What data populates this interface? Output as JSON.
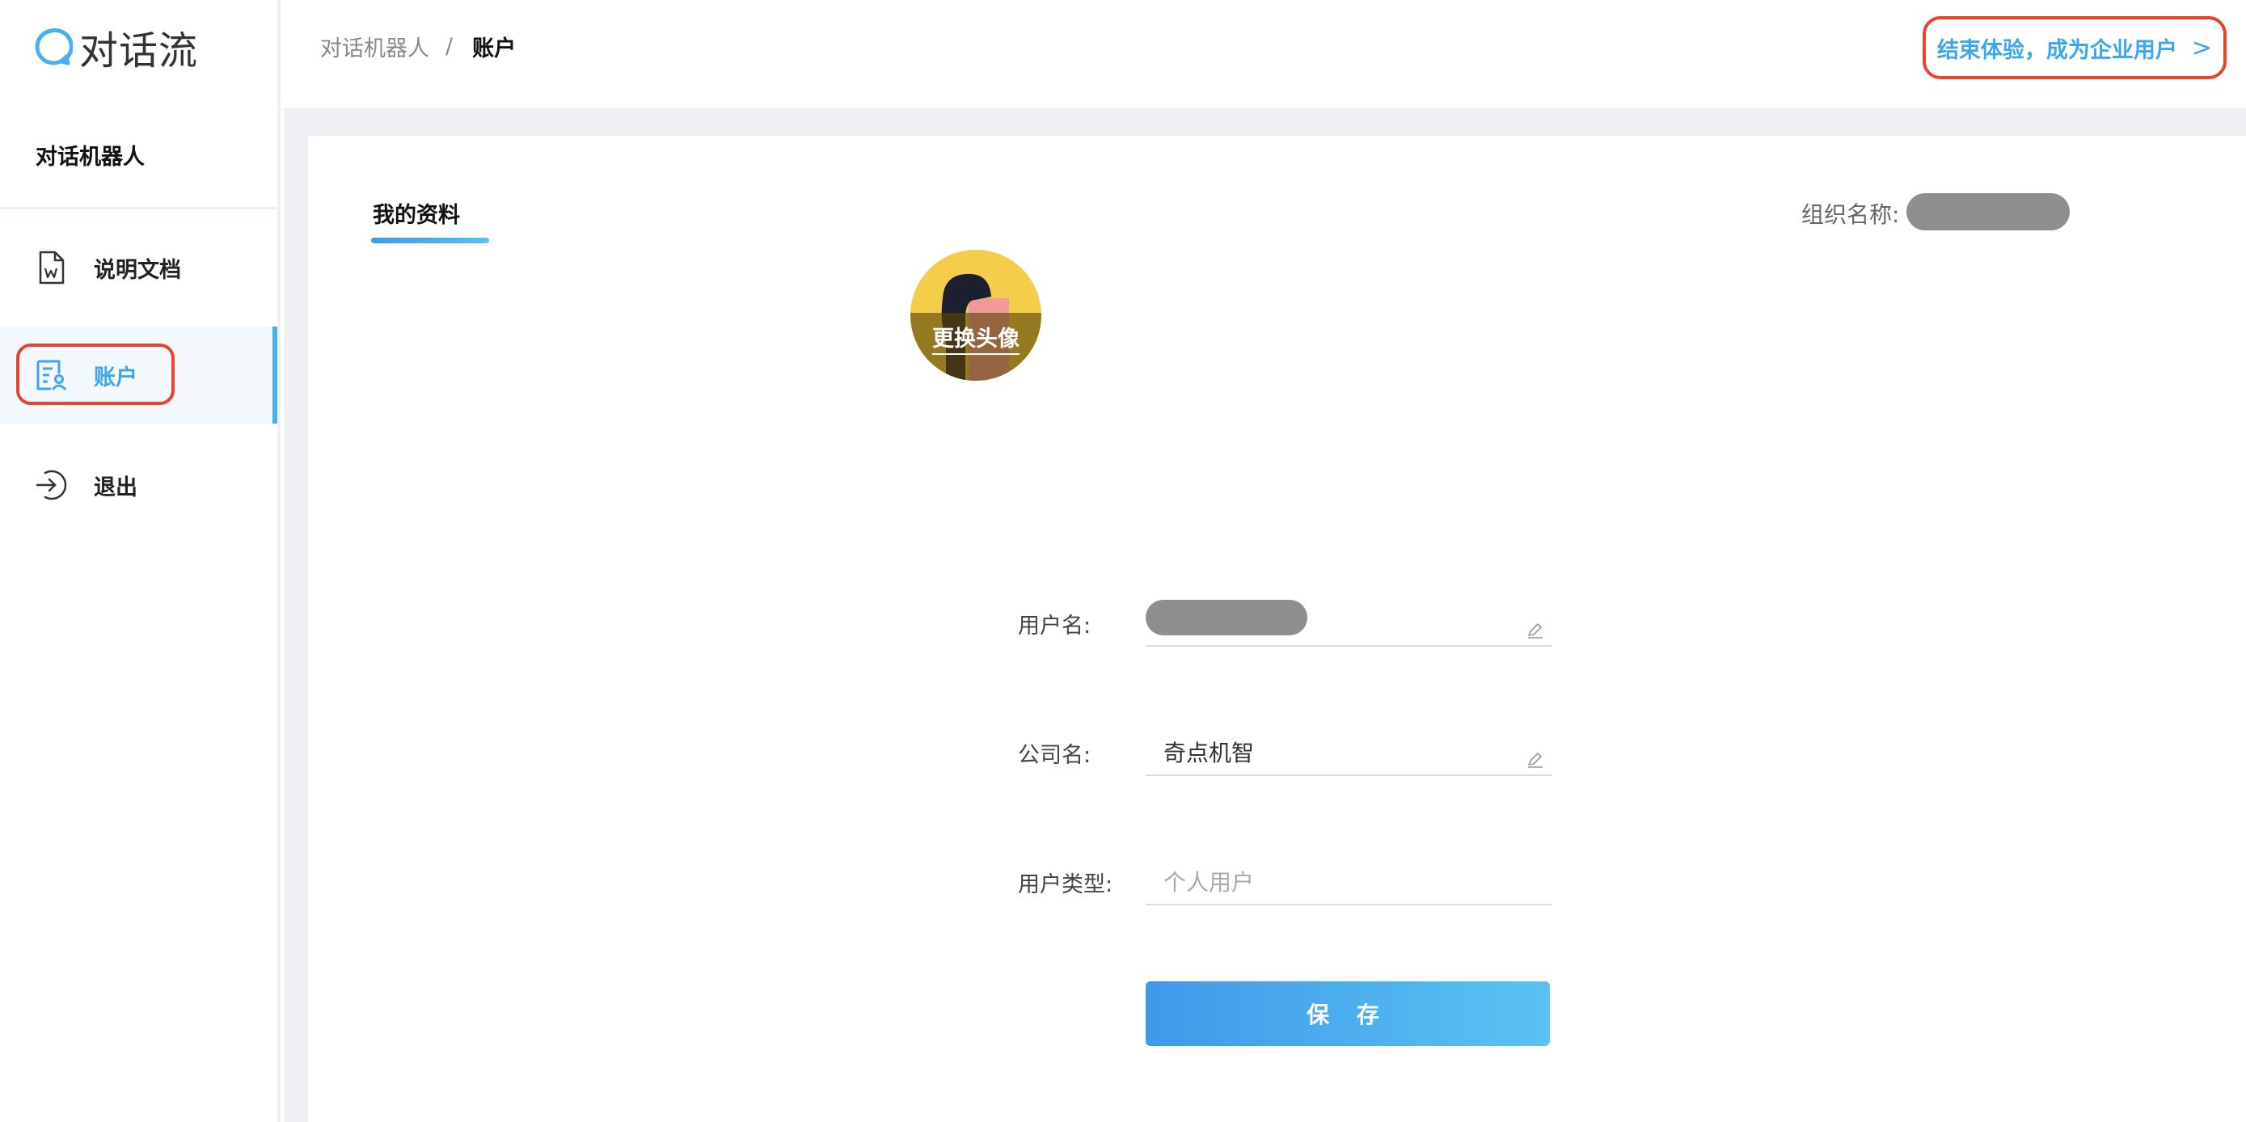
{
  "app": {
    "name": "对话流"
  },
  "sidebar": {
    "section_title": "对话机器人",
    "items": [
      {
        "label": "说明文档",
        "icon": "word-document-icon"
      },
      {
        "label": "账户",
        "icon": "account-card-icon",
        "active": true
      },
      {
        "label": "退出",
        "icon": "logout-icon"
      }
    ]
  },
  "header": {
    "breadcrumb": {
      "parent": "对话机器人",
      "separator": "/",
      "current": "账户"
    },
    "upgrade_label": "结束体验，成为企业用户",
    "upgrade_chevron": ">"
  },
  "profile": {
    "tab_label": "我的资料",
    "org_label": "组织名称:",
    "avatar_action": "更换头像",
    "fields": {
      "username": {
        "label": "用户名:"
      },
      "company": {
        "label": "公司名:",
        "value": "奇点机智"
      },
      "user_type": {
        "label": "用户类型:",
        "value": "个人用户"
      }
    },
    "save_label": "保 存"
  },
  "colors": {
    "accent": "#3ea6ec",
    "highlight": "#e3452f",
    "button_start": "#3f99ea",
    "button_end": "#5ac3f2",
    "redacted": "#8e8e8e"
  }
}
